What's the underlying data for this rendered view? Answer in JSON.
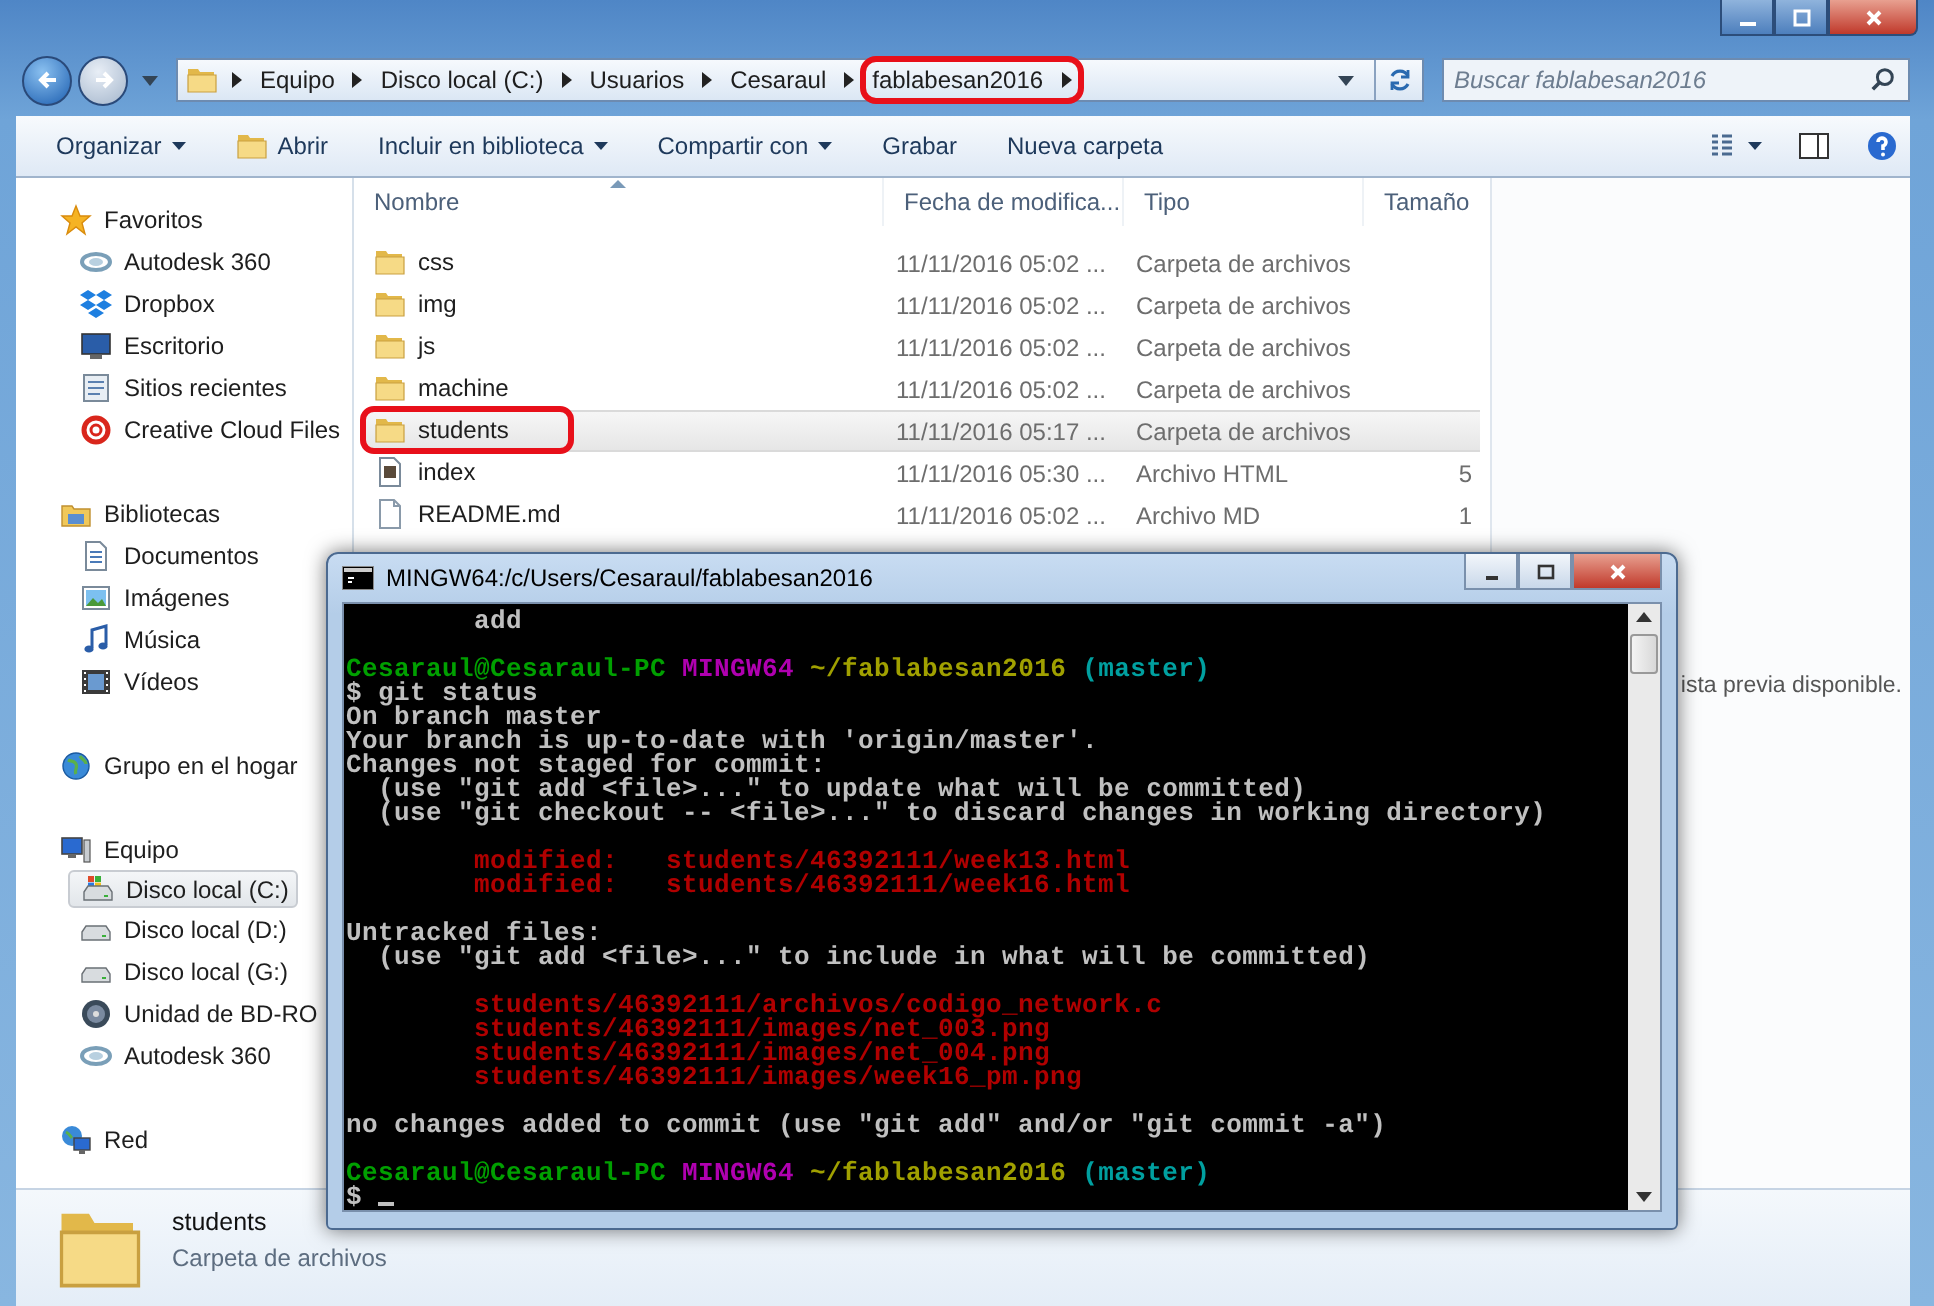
{
  "explorer": {
    "address_bar": {
      "breadcrumbs": [
        {
          "label": "Equipo",
          "highlighted": false
        },
        {
          "label": "Disco local (C:)",
          "highlighted": false
        },
        {
          "label": "Usuarios",
          "highlighted": false
        },
        {
          "label": "Cesaraul",
          "highlighted": false
        },
        {
          "label": "fablabesan2016",
          "highlighted": true
        }
      ]
    },
    "search": {
      "placeholder": "Buscar fablabesan2016"
    },
    "toolbar": [
      {
        "label": "Organizar",
        "dropdown": true
      },
      {
        "label": "Abrir",
        "dropdown": false
      },
      {
        "label": "Incluir en biblioteca",
        "dropdown": true
      },
      {
        "label": "Compartir con",
        "dropdown": true
      },
      {
        "label": "Grabar",
        "dropdown": false
      },
      {
        "label": "Nueva carpeta",
        "dropdown": false
      }
    ],
    "sidebar": [
      {
        "label": "Favoritos",
        "selected": false,
        "children": [
          {
            "label": "Autodesk 360",
            "selected": false
          },
          {
            "label": "Dropbox",
            "selected": false
          },
          {
            "label": "Escritorio",
            "selected": false
          },
          {
            "label": "Sitios recientes",
            "selected": false
          },
          {
            "label": "Creative Cloud Files",
            "selected": false
          }
        ]
      },
      {
        "label": "Bibliotecas",
        "selected": false,
        "children": [
          {
            "label": "Documentos",
            "selected": false
          },
          {
            "label": "Imágenes",
            "selected": false
          },
          {
            "label": "Música",
            "selected": false
          },
          {
            "label": "Vídeos",
            "selected": false
          }
        ]
      },
      {
        "label": "Grupo en el hogar",
        "selected": false
      },
      {
        "label": "Equipo",
        "selected": false,
        "children": [
          {
            "label": "Disco local (C:)",
            "selected": true
          },
          {
            "label": "Disco local (D:)",
            "selected": false
          },
          {
            "label": "Disco local (G:)",
            "selected": false
          },
          {
            "label": "Unidad de BD-RO",
            "selected": false
          },
          {
            "label": "Autodesk 360",
            "selected": false
          }
        ]
      },
      {
        "label": "Red",
        "selected": false
      }
    ],
    "file_list": {
      "columns": [
        {
          "label": "Nombre",
          "sorted": true
        },
        {
          "label": "Fecha de modifica...",
          "sorted": false
        },
        {
          "label": "Tipo",
          "sorted": false
        },
        {
          "label": "Tamaño",
          "sorted": false
        }
      ],
      "rows": [
        {
          "name": "css",
          "date": "11/11/2016 05:02 ...",
          "type": "Carpeta de archivos",
          "kind": "folder",
          "selected": false,
          "highlighted": false
        },
        {
          "name": "img",
          "date": "11/11/2016 05:02 ...",
          "type": "Carpeta de archivos",
          "kind": "folder",
          "selected": false,
          "highlighted": false
        },
        {
          "name": "js",
          "date": "11/11/2016 05:02 ...",
          "type": "Carpeta de archivos",
          "kind": "folder",
          "selected": false,
          "highlighted": false
        },
        {
          "name": "machine",
          "date": "11/11/2016 05:02 ...",
          "type": "Carpeta de archivos",
          "kind": "folder",
          "selected": false,
          "highlighted": false
        },
        {
          "name": "students",
          "date": "11/11/2016 05:17 ...",
          "type": "Carpeta de archivos",
          "kind": "folder",
          "selected": true,
          "highlighted": true
        },
        {
          "name": "index",
          "date": "11/11/2016 05:30 ...",
          "type": "Archivo HTML",
          "size": "5",
          "kind": "html",
          "selected": false,
          "highlighted": false
        },
        {
          "name": "README.md",
          "date": "11/11/2016 05:02 ...",
          "type": "Archivo MD",
          "size": "1",
          "kind": "text",
          "selected": false,
          "highlighted": false
        }
      ]
    },
    "preview": {
      "message": "ista previa disponible."
    },
    "details": {
      "name": "students",
      "type": "Carpeta de archivos"
    }
  },
  "terminal": {
    "title": "MINGW64:/c/Users/Cesaraul/fablabesan2016",
    "cursor_visible": true,
    "lines": [
      {
        "gap_before": false,
        "segments": [
          {
            "text": "        add",
            "color": "#c0c0c0"
          }
        ]
      },
      {
        "gap_before": true,
        "segments": [
          {
            "text": "Cesaraul@Cesaraul-PC ",
            "color": "#00a000"
          },
          {
            "text": "MINGW64 ",
            "color": "#b000b0"
          },
          {
            "text": "~/fablabesan2016 ",
            "color": "#a0a000"
          },
          {
            "text": "(master)",
            "color": "#00a0a0"
          }
        ]
      },
      {
        "gap_before": false,
        "segments": [
          {
            "text": "$ git status",
            "color": "#c0c0c0"
          }
        ]
      },
      {
        "gap_before": false,
        "segments": [
          {
            "text": "On branch master",
            "color": "#c0c0c0"
          }
        ]
      },
      {
        "gap_before": false,
        "segments": [
          {
            "text": "Your branch is up-to-date with 'origin/master'.",
            "color": "#c0c0c0"
          }
        ]
      },
      {
        "gap_before": false,
        "segments": [
          {
            "text": "Changes not staged for commit:",
            "color": "#c0c0c0"
          }
        ]
      },
      {
        "gap_before": false,
        "segments": [
          {
            "text": "  (use \"git add <file>...\" to update what will be committed)",
            "color": "#c0c0c0"
          }
        ]
      },
      {
        "gap_before": false,
        "segments": [
          {
            "text": "  (use \"git checkout -- <file>...\" to discard changes in working directory)",
            "color": "#c0c0c0"
          }
        ]
      },
      {
        "gap_before": true,
        "segments": [
          {
            "text": "        modified:   students/46392111/week13.html",
            "color": "#b00000"
          }
        ]
      },
      {
        "gap_before": false,
        "segments": [
          {
            "text": "        modified:   students/46392111/week16.html",
            "color": "#b00000"
          }
        ]
      },
      {
        "gap_before": true,
        "segments": [
          {
            "text": "Untracked files:",
            "color": "#c0c0c0"
          }
        ]
      },
      {
        "gap_before": false,
        "segments": [
          {
            "text": "  (use \"git add <file>...\" to include in what will be committed)",
            "color": "#c0c0c0"
          }
        ]
      },
      {
        "gap_before": true,
        "segments": [
          {
            "text": "        students/46392111/archivos/codigo_network.c",
            "color": "#b00000"
          }
        ]
      },
      {
        "gap_before": false,
        "segments": [
          {
            "text": "        students/46392111/images/net_003.png",
            "color": "#b00000"
          }
        ]
      },
      {
        "gap_before": false,
        "segments": [
          {
            "text": "        students/46392111/images/net_004.png",
            "color": "#b00000"
          }
        ]
      },
      {
        "gap_before": false,
        "segments": [
          {
            "text": "        students/46392111/images/week16_pm.png",
            "color": "#b00000"
          }
        ]
      },
      {
        "gap_before": true,
        "segments": [
          {
            "text": "no changes added to commit (use \"git add\" and/or \"git commit -a\")",
            "color": "#c0c0c0"
          }
        ]
      },
      {
        "gap_before": true,
        "segments": [
          {
            "text": "Cesaraul@Cesaraul-PC ",
            "color": "#00a000"
          },
          {
            "text": "MINGW64 ",
            "color": "#b000b0"
          },
          {
            "text": "~/fablabesan2016 ",
            "color": "#a0a000"
          },
          {
            "text": "(master)",
            "color": "#00a0a0"
          }
        ]
      },
      {
        "gap_before": false,
        "segments": [
          {
            "text": "$ ",
            "color": "#c0c0c0"
          }
        ]
      }
    ]
  }
}
